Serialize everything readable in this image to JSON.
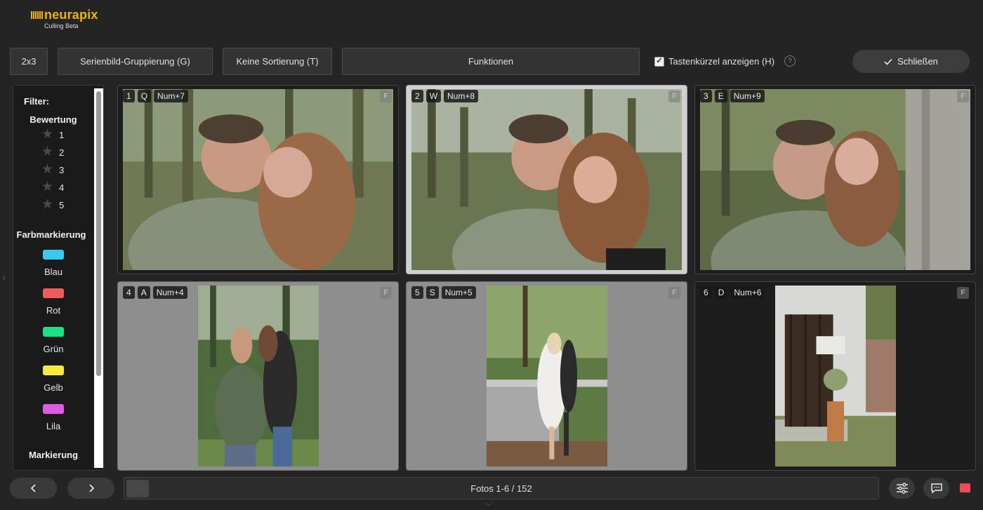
{
  "app": {
    "logo_text": "neurapix",
    "subtitle": "Culling Beta",
    "brand_color": "#f0b400"
  },
  "toolbar": {
    "grid_label": "2x3",
    "grouping_label": "Serienbild-Gruppierung (G)",
    "sort_label": "Keine Sortierung (T)",
    "functions_label": "Funktionen",
    "shortcuts_label": "Tastenkürzel anzeigen (H)",
    "shortcuts_checked": true,
    "help_symbol": "?",
    "close_label": "Schließen",
    "close_icon": "checkmark-icon"
  },
  "filter": {
    "title": "Filter:",
    "rating_heading": "Bewertung",
    "ratings": [
      "1",
      "2",
      "3",
      "4",
      "5"
    ],
    "color_heading": "Farbmarkierung",
    "colors": [
      {
        "label": "Blau",
        "color": "#3cc8f0"
      },
      {
        "label": "Rot",
        "color": "#f05a5a"
      },
      {
        "label": "Grün",
        "color": "#1de084"
      },
      {
        "label": "Gelb",
        "color": "#f7ea3a"
      },
      {
        "label": "Lila",
        "color": "#e05ae6"
      }
    ],
    "mark_heading": "Markierung"
  },
  "photos": [
    {
      "number": "1",
      "key": "Q",
      "numkey": "Num+7",
      "flag": "F",
      "state": "dark",
      "description": "couple kissing in forest"
    },
    {
      "number": "2",
      "key": "W",
      "numkey": "Num+8",
      "flag": "F",
      "state": "selected",
      "description": "couple kissing in forest"
    },
    {
      "number": "3",
      "key": "E",
      "numkey": "Num+9",
      "flag": "F",
      "state": "dark",
      "description": "woman kissing man's cheek"
    },
    {
      "number": "4",
      "key": "A",
      "numkey": "Num+4",
      "flag": "F",
      "state": "gray",
      "description": "embracing couple"
    },
    {
      "number": "5",
      "key": "S",
      "numkey": "Num+5",
      "flag": "F",
      "state": "gray",
      "description": "couple on wooden bridge"
    },
    {
      "number": "6",
      "key": "D",
      "numkey": "Num+6",
      "flag": "F",
      "state": "dark",
      "description": "barn door with cat sign"
    }
  ],
  "footer": {
    "prev_icon": "chevron-left-icon",
    "next_icon": "chevron-right-icon",
    "status_text": "Fotos 1-6 / 152",
    "settings_icon": "sliders-icon",
    "chat_icon": "chat-icon",
    "record_color": "#ef4a56"
  }
}
